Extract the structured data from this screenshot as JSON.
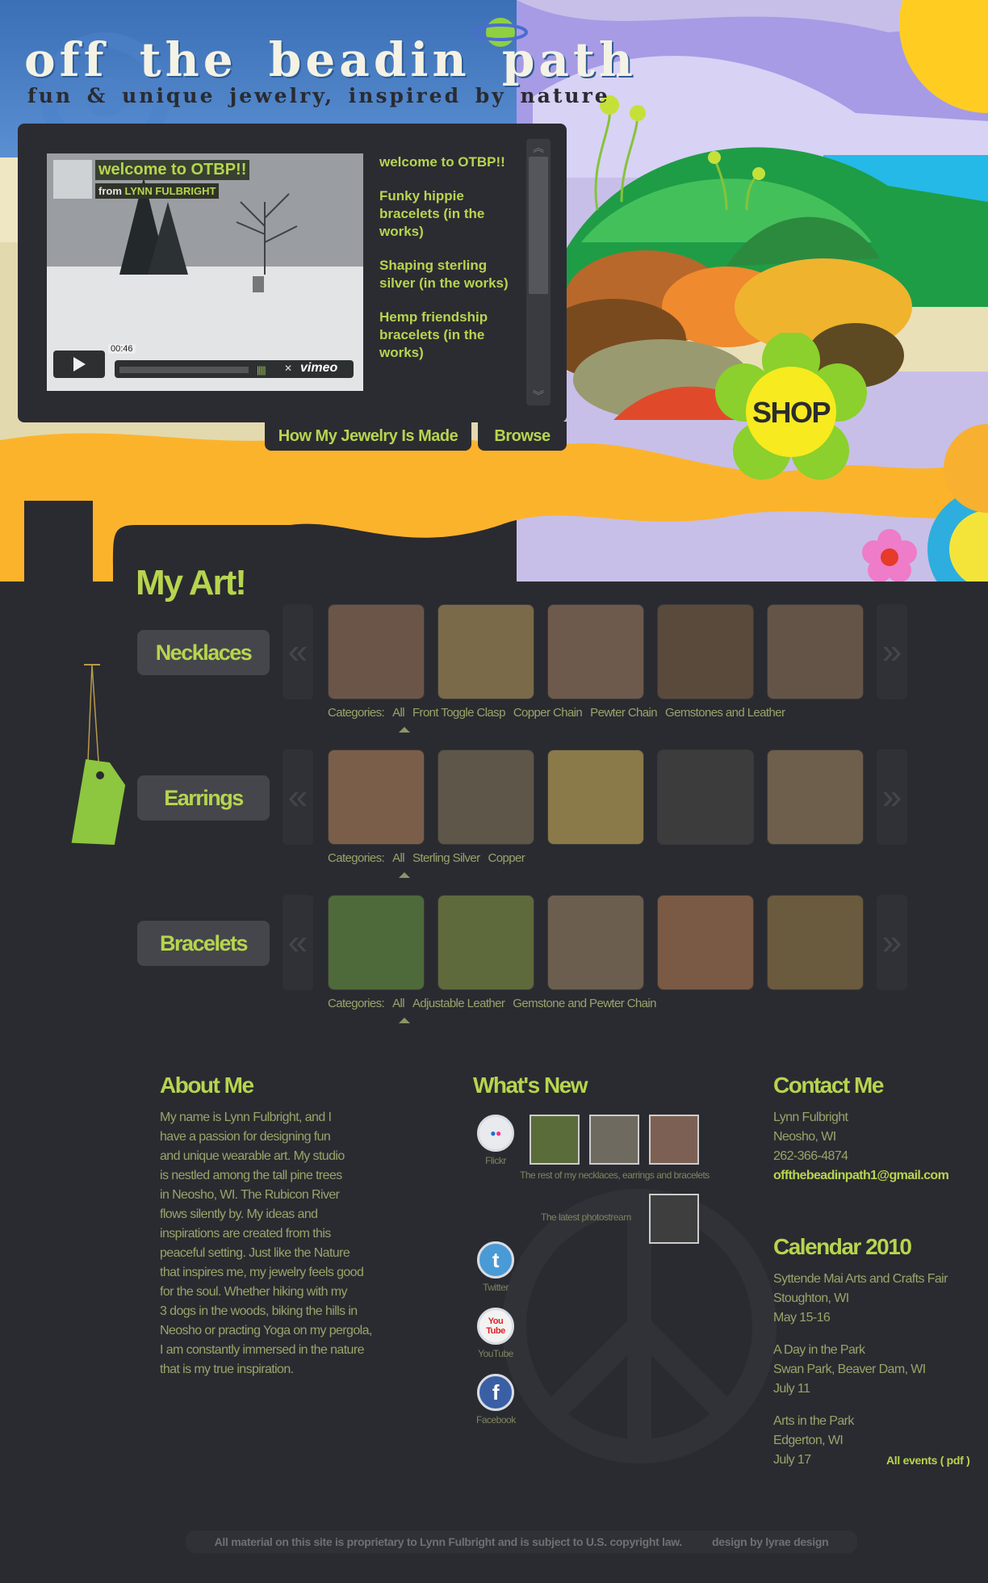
{
  "header": {
    "site_title": "off the beadin path",
    "tagline": "fun & unique jewelry, inspired by nature",
    "shop_label": "SHOP"
  },
  "video": {
    "title": "welcome to OTBP!!",
    "from_prefix": "from",
    "from_name": "LYNN FULBRIGHT",
    "time": "00:46",
    "brand": "vimeo",
    "playlist": [
      "welcome to OTBP!!",
      "Funky hippie bracelets (in the works)",
      "Shaping sterling silver (in the works)",
      "Hemp friendship bracelets (in the works)"
    ]
  },
  "video_tabs": {
    "how_made": "How My Jewelry Is Made",
    "browse": "Browse"
  },
  "art": {
    "title": "My Art!",
    "prev_glyph": "«",
    "next_glyph": "»",
    "categories_label": "Categories:",
    "galleries": [
      {
        "name": "Necklaces",
        "categories": [
          "All",
          "Front Toggle Clasp",
          "Copper Chain",
          "Pewter Chain",
          "Gemstones and Leather"
        ]
      },
      {
        "name": "Earrings",
        "categories": [
          "All",
          "Sterling Silver",
          "Copper"
        ]
      },
      {
        "name": "Bracelets",
        "categories": [
          "All",
          "Adjustable Leather",
          "Gemstone and Pewter Chain"
        ]
      }
    ]
  },
  "about": {
    "title": "About Me",
    "lines": [
      "My name is Lynn Fulbright, and I",
      "have a passion for designing fun",
      "and unique wearable art.  My studio",
      "is nestled among the tall pine trees",
      "in Neosho, WI. The Rubicon River",
      "flows silently by.  My ideas and",
      "inspirations are created from this",
      "peaceful setting.  Just like the Nature",
      "that inspires me, my jewelry feels good",
      "for the soul.  Whether hiking with my",
      "3 dogs in the woods, biking the hills in",
      "Neosho or practing Yoga on my pergola,",
      "I am constantly immersed in the nature",
      "that is my true inspiration."
    ]
  },
  "whats_new": {
    "title": "What's New",
    "flickr": "Flickr",
    "flickr_caption": "The rest of my necklaces, earrings and bracelets",
    "photostream": "The latest photostream",
    "twitter": "Twitter",
    "youtube": "YouTube",
    "facebook": "Facebook"
  },
  "contact": {
    "title": "Contact Me",
    "name": "Lynn Fulbright",
    "location": "Neosho, WI",
    "phone": "262-366-4874",
    "email": "offthebeadinpath1@gmail.com"
  },
  "calendar": {
    "title": "Calendar 2010",
    "events": [
      {
        "name": "Syttende Mai Arts and Crafts Fair",
        "place": "Stoughton, WI",
        "date": "May 15-16"
      },
      {
        "name": "A Day in the Park",
        "place": "Swan Park, Beaver Dam, WI",
        "date": "July 11"
      },
      {
        "name": "Arts in the Park",
        "place": "Edgerton, WI",
        "date": "July 17"
      }
    ],
    "all_events": "All events ( pdf )"
  },
  "footer": {
    "copyright": "All material on this site is proprietary to Lynn Fulbright and is subject to U.S. copyright law.",
    "credit": "design by lyrae design"
  },
  "colors": {
    "background": "#2a2b30",
    "accent_green": "#b7d44f",
    "orange": "#fcb32c",
    "sky_blue": "#3a78c6"
  }
}
